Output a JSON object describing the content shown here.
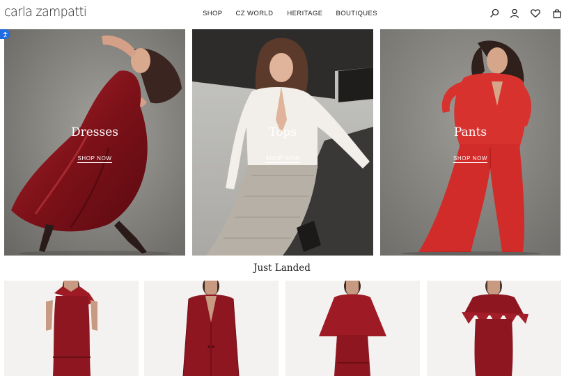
{
  "brand": {
    "logo_text": "carla zampatti"
  },
  "nav": {
    "items": [
      {
        "label": "SHOP"
      },
      {
        "label": "CZ WORLD"
      },
      {
        "label": "HERITAGE"
      },
      {
        "label": "BOUTIQUES"
      }
    ]
  },
  "header_icons": [
    "search-icon",
    "account-icon",
    "wishlist-icon",
    "bag-icon"
  ],
  "hero": {
    "tiles": [
      {
        "title": "Dresses",
        "cta": "SHOP NOW"
      },
      {
        "title": "Tops",
        "cta": "SHOP NOW"
      },
      {
        "title": "Pants",
        "cta": "SHOP NOW"
      }
    ]
  },
  "just_landed": {
    "heading": "Just Landed"
  },
  "colors": {
    "brand_red": "#8e1620",
    "bright_red": "#d8322e",
    "background": "#ffffff",
    "product_bg": "#f3f2f1"
  }
}
